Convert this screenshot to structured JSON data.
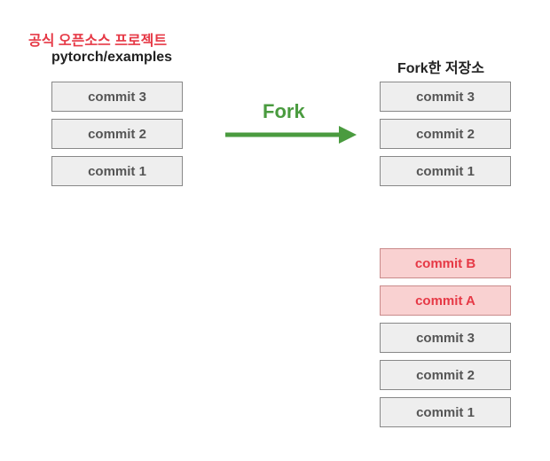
{
  "left": {
    "title_red": "공식 오픈소스 프로젝트",
    "title_black": "pytorch/examples",
    "commits": [
      "commit 3",
      "commit 2",
      "commit 1"
    ]
  },
  "right_top": {
    "title_black": "Fork한 저장소",
    "commits": [
      "commit 3",
      "commit 2",
      "commit 1"
    ]
  },
  "right_bottom": {
    "commits_new": [
      "commit B",
      "commit A"
    ],
    "commits_old": [
      "commit 3",
      "commit 2",
      "commit 1"
    ]
  },
  "fork_label": "Fork",
  "colors": {
    "red": "#e63946",
    "green": "#4a9b3f",
    "gray_box": "#eeeeee",
    "pink_box": "#f9d1d1"
  }
}
